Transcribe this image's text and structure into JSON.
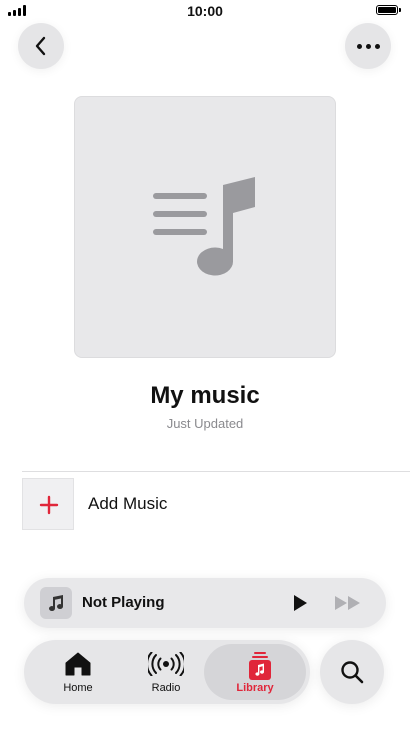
{
  "status_bar": {
    "time": "10:00"
  },
  "playlist": {
    "title": "My music",
    "subtitle": "Just Updated"
  },
  "actions": {
    "add_music_label": "Add Music"
  },
  "mini_player": {
    "label": "Not Playing"
  },
  "tab_bar": {
    "tabs": [
      {
        "label": "Home",
        "icon": "home-icon"
      },
      {
        "label": "Radio",
        "icon": "radio-icon"
      },
      {
        "label": "Library",
        "icon": "library-icon",
        "selected": true
      }
    ]
  },
  "colors": {
    "accent": "#e0263a",
    "background": "#ffffff",
    "placeholder": "#e8e8ea"
  }
}
